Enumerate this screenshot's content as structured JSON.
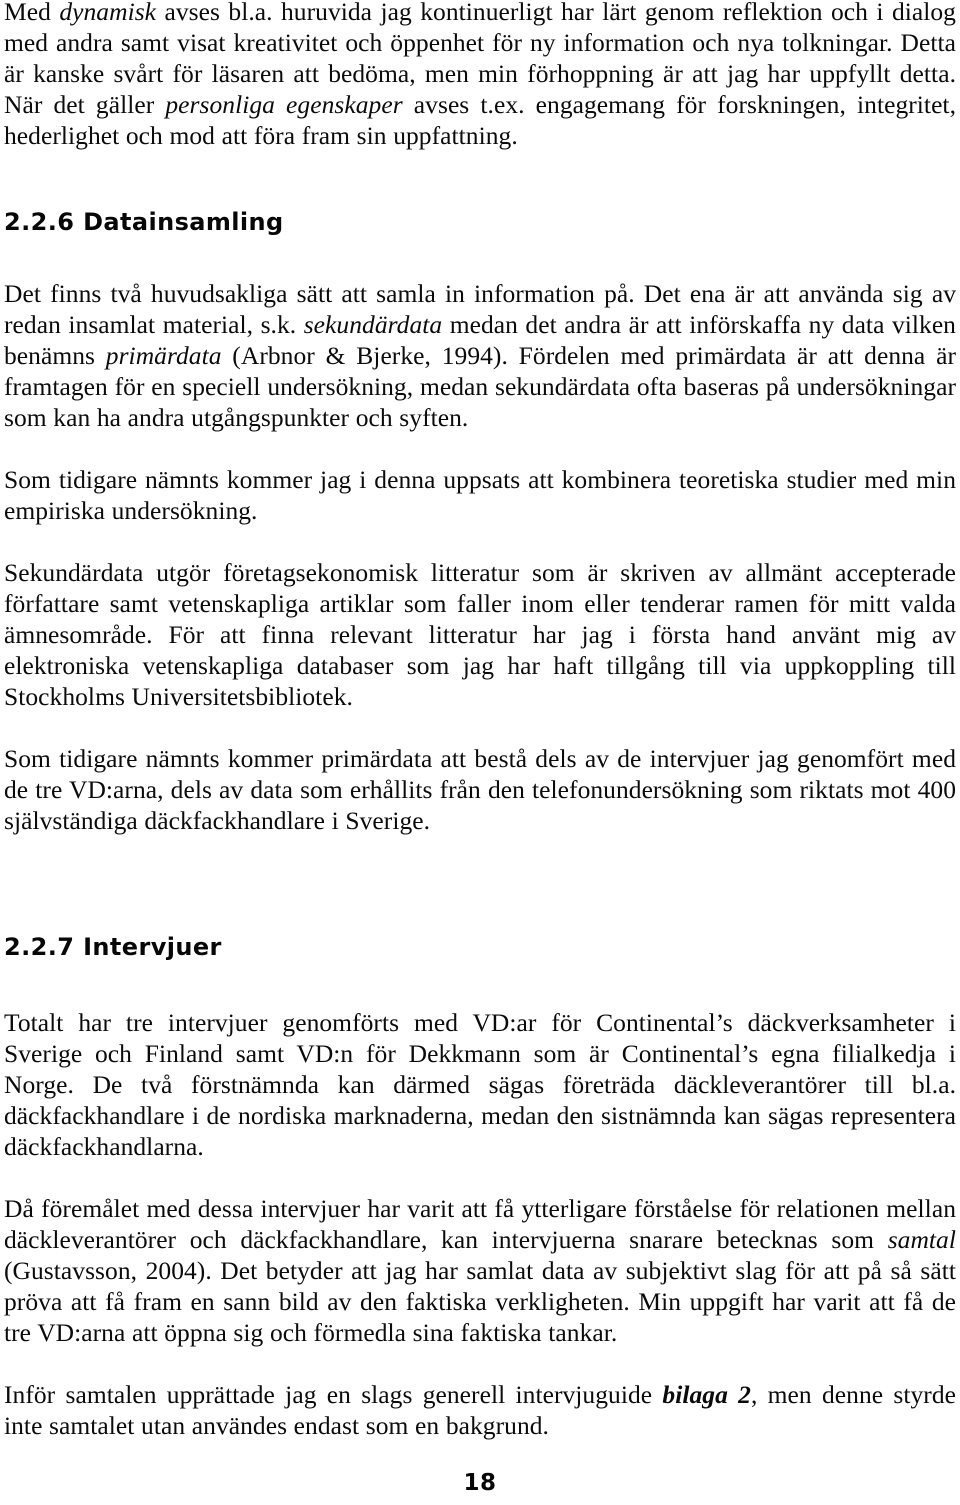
{
  "document": {
    "page_number": "18",
    "language": "sv"
  },
  "content": {
    "paragraph_1": {
      "run_1": "Med ",
      "run_2_italic": "dynamisk",
      "run_3": " avses bl.a. huruvida jag kontinuerligt har lärt genom reflektion och i dialog med andra samt visat kreativitet och öppenhet för ny information och nya tolkningar. Detta är kanske svårt för läsaren att bedöma, men min förhoppning är att jag har uppfyllt detta. När det gäller ",
      "run_4_italic": "personliga egenskaper",
      "run_5": " avses t.ex. engagemang för forskningen, integritet, hederlighet och mod att föra fram sin uppfattning."
    },
    "heading_1": "2.2.6 Datainsamling",
    "paragraph_2": {
      "run_1": "Det finns två huvudsakliga sätt att samla in information på. Det ena är att använda sig av redan insamlat material, s.k. ",
      "run_2_italic": "sekundärdata",
      "run_3": " medan det andra är att införskaffa ny data vilken benämns ",
      "run_4_italic": "primärdata",
      "run_5": " (Arbnor & Bjerke, 1994). Fördelen med primärdata är att denna är framtagen för en speciell undersökning, medan sekundärdata ofta baseras på undersökningar som kan ha andra utgångspunkter och syften."
    },
    "paragraph_3": "Som tidigare nämnts kommer jag i denna uppsats att kombinera teoretiska studier med min empiriska undersökning.",
    "paragraph_4": "Sekundärdata utgör företagsekonomisk litteratur som är skriven av allmänt accepterade författare samt vetenskapliga artiklar som faller inom eller tenderar ramen för mitt valda ämnesområde. För att finna relevant litteratur har jag i första hand använt mig av elektroniska vetenskapliga databaser som jag har haft tillgång till via uppkoppling till Stockholms Universitetsbibliotek.",
    "paragraph_5": "Som tidigare nämnts kommer primärdata att bestå dels av de intervjuer jag genomfört med de tre VD:arna, dels av data som erhållits från den telefonundersökning som riktats mot 400 självständiga däckfackhandlare i Sverige.",
    "heading_2": "2.2.7 Intervjuer",
    "paragraph_6": "Totalt har tre intervjuer genomförts med VD:ar för Continental’s däckverksamheter i Sverige och Finland samt VD:n för Dekkmann som är Continental’s egna filialkedja i Norge. De två förstnämnda kan därmed sägas företräda däckleverantörer till bl.a. däckfackhandlare i de nordiska marknaderna, medan den sistnämnda kan sägas representera däckfackhandlarna.",
    "paragraph_7": {
      "run_1": "Då föremålet med dessa intervjuer har varit att få ytterligare förståelse för relationen mellan däckleverantörer och däckfackhandlare, kan intervjuerna snarare betecknas som ",
      "run_2_italic": "samtal",
      "run_3": " (Gustavsson, 2004). Det betyder att jag har samlat data av subjektivt slag för att på så sätt pröva att få fram en sann bild av den faktiska verkligheten. Min uppgift har varit att få de tre VD:arna att öppna sig och förmedla sina faktiska tankar."
    },
    "paragraph_8": {
      "run_1": "Inför samtalen upprättade jag en slags generell intervjuguide ",
      "run_2_bold_italic": "bilaga 2",
      "run_3": ", men denne styrde inte samtalet utan användes endast som en bakgrund."
    }
  }
}
